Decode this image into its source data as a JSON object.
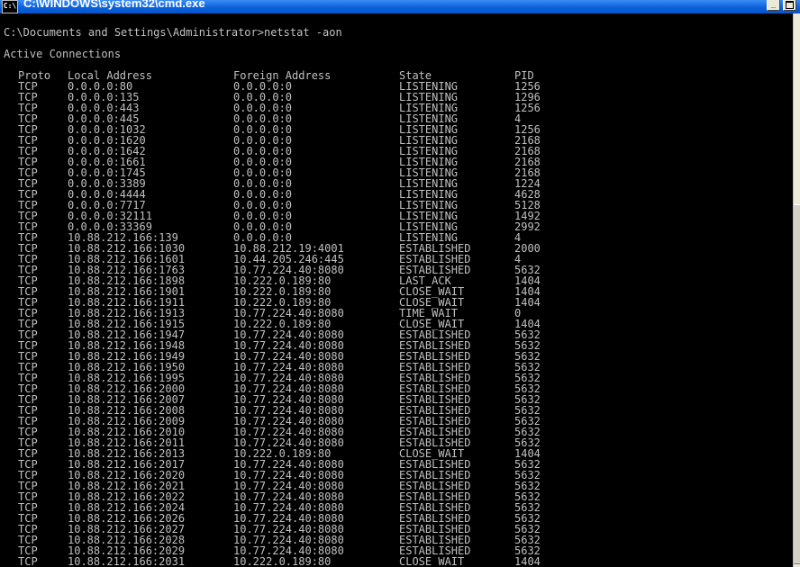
{
  "window": {
    "title": "C:\\WINDOWS\\system32\\cmd.exe",
    "icon_label": "C:\\",
    "minimize_label": "_"
  },
  "console": {
    "prompt_line": "C:\\Documents and Settings\\Administrator>netstat -aon",
    "heading": "Active Connections",
    "columns": [
      "Proto",
      "Local Address",
      "Foreign Address",
      "State",
      "PID"
    ],
    "rows": [
      [
        "TCP",
        "0.0.0.0:80",
        "0.0.0.0:0",
        "LISTENING",
        "1256"
      ],
      [
        "TCP",
        "0.0.0.0:135",
        "0.0.0.0:0",
        "LISTENING",
        "1296"
      ],
      [
        "TCP",
        "0.0.0.0:443",
        "0.0.0.0:0",
        "LISTENING",
        "1256"
      ],
      [
        "TCP",
        "0.0.0.0:445",
        "0.0.0.0:0",
        "LISTENING",
        "4"
      ],
      [
        "TCP",
        "0.0.0.0:1032",
        "0.0.0.0:0",
        "LISTENING",
        "1256"
      ],
      [
        "TCP",
        "0.0.0.0:1620",
        "0.0.0.0:0",
        "LISTENING",
        "2168"
      ],
      [
        "TCP",
        "0.0.0.0:1642",
        "0.0.0.0:0",
        "LISTENING",
        "2168"
      ],
      [
        "TCP",
        "0.0.0.0:1661",
        "0.0.0.0:0",
        "LISTENING",
        "2168"
      ],
      [
        "TCP",
        "0.0.0.0:1745",
        "0.0.0.0:0",
        "LISTENING",
        "2168"
      ],
      [
        "TCP",
        "0.0.0.0:3389",
        "0.0.0.0:0",
        "LISTENING",
        "1224"
      ],
      [
        "TCP",
        "0.0.0.0:4444",
        "0.0.0.0:0",
        "LISTENING",
        "4628"
      ],
      [
        "TCP",
        "0.0.0.0:7717",
        "0.0.0.0:0",
        "LISTENING",
        "5128"
      ],
      [
        "TCP",
        "0.0.0.0:32111",
        "0.0.0.0:0",
        "LISTENING",
        "1492"
      ],
      [
        "TCP",
        "0.0.0.0:33369",
        "0.0.0.0:0",
        "LISTENING",
        "2992"
      ],
      [
        "TCP",
        "10.88.212.166:139",
        "0.0.0.0:0",
        "LISTENING",
        "4"
      ],
      [
        "TCP",
        "10.88.212.166:1030",
        "10.88.212.19:4001",
        "ESTABLISHED",
        "2000"
      ],
      [
        "TCP",
        "10.88.212.166:1601",
        "10.44.205.246:445",
        "ESTABLISHED",
        "4"
      ],
      [
        "TCP",
        "10.88.212.166:1763",
        "10.77.224.40:8080",
        "ESTABLISHED",
        "5632"
      ],
      [
        "TCP",
        "10.88.212.166:1898",
        "10.222.0.189:80",
        "LAST_ACK",
        "1404"
      ],
      [
        "TCP",
        "10.88.212.166:1901",
        "10.222.0.189:80",
        "CLOSE_WAIT",
        "1404"
      ],
      [
        "TCP",
        "10.88.212.166:1911",
        "10.222.0.189:80",
        "CLOSE_WAIT",
        "1404"
      ],
      [
        "TCP",
        "10.88.212.166:1913",
        "10.77.224.40:8080",
        "TIME_WAIT",
        "0"
      ],
      [
        "TCP",
        "10.88.212.166:1915",
        "10.222.0.189:80",
        "CLOSE_WAIT",
        "1404"
      ],
      [
        "TCP",
        "10.88.212.166:1947",
        "10.77.224.40:8080",
        "ESTABLISHED",
        "5632"
      ],
      [
        "TCP",
        "10.88.212.166:1948",
        "10.77.224.40:8080",
        "ESTABLISHED",
        "5632"
      ],
      [
        "TCP",
        "10.88.212.166:1949",
        "10.77.224.40:8080",
        "ESTABLISHED",
        "5632"
      ],
      [
        "TCP",
        "10.88.212.166:1950",
        "10.77.224.40:8080",
        "ESTABLISHED",
        "5632"
      ],
      [
        "TCP",
        "10.88.212.166:1995",
        "10.77.224.40:8080",
        "ESTABLISHED",
        "5632"
      ],
      [
        "TCP",
        "10.88.212.166:2000",
        "10.77.224.40:8080",
        "ESTABLISHED",
        "5632"
      ],
      [
        "TCP",
        "10.88.212.166:2007",
        "10.77.224.40:8080",
        "ESTABLISHED",
        "5632"
      ],
      [
        "TCP",
        "10.88.212.166:2008",
        "10.77.224.40:8080",
        "ESTABLISHED",
        "5632"
      ],
      [
        "TCP",
        "10.88.212.166:2009",
        "10.77.224.40:8080",
        "ESTABLISHED",
        "5632"
      ],
      [
        "TCP",
        "10.88.212.166:2010",
        "10.77.224.40:8080",
        "ESTABLISHED",
        "5632"
      ],
      [
        "TCP",
        "10.88.212.166:2011",
        "10.77.224.40:8080",
        "ESTABLISHED",
        "5632"
      ],
      [
        "TCP",
        "10.88.212.166:2013",
        "10.222.0.189:80",
        "CLOSE_WAIT",
        "1404"
      ],
      [
        "TCP",
        "10.88.212.166:2017",
        "10.77.224.40:8080",
        "ESTABLISHED",
        "5632"
      ],
      [
        "TCP",
        "10.88.212.166:2020",
        "10.77.224.40:8080",
        "ESTABLISHED",
        "5632"
      ],
      [
        "TCP",
        "10.88.212.166:2021",
        "10.77.224.40:8080",
        "ESTABLISHED",
        "5632"
      ],
      [
        "TCP",
        "10.88.212.166:2022",
        "10.77.224.40:8080",
        "ESTABLISHED",
        "5632"
      ],
      [
        "TCP",
        "10.88.212.166:2024",
        "10.77.224.40:8080",
        "ESTABLISHED",
        "5632"
      ],
      [
        "TCP",
        "10.88.212.166:2026",
        "10.77.224.40:8080",
        "ESTABLISHED",
        "5632"
      ],
      [
        "TCP",
        "10.88.212.166:2027",
        "10.77.224.40:8080",
        "ESTABLISHED",
        "5632"
      ],
      [
        "TCP",
        "10.88.212.166:2028",
        "10.77.224.40:8080",
        "ESTABLISHED",
        "5632"
      ],
      [
        "TCP",
        "10.88.212.166:2029",
        "10.77.224.40:8080",
        "ESTABLISHED",
        "5632"
      ],
      [
        "TCP",
        "10.88.212.166:2031",
        "10.222.0.189:80",
        "CLOSE_WAIT",
        "1404"
      ]
    ]
  },
  "colors": {
    "console_bg": "#000000",
    "console_text": "#c0c0c0",
    "titlebar": "#0a5fd8"
  }
}
